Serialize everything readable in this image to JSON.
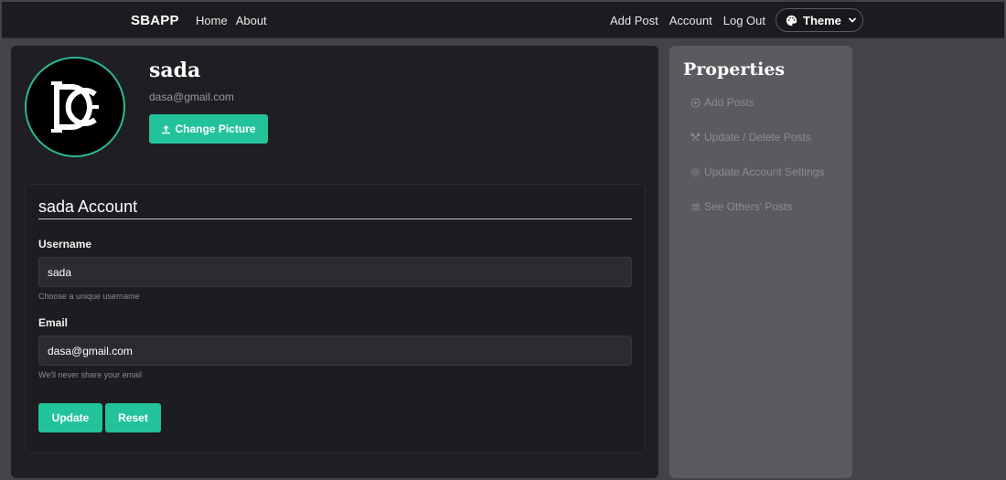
{
  "navbar": {
    "brand": "SBAPP",
    "left_links": [
      "Home",
      "About"
    ],
    "right_links": [
      "Add Post",
      "Account",
      "Log Out"
    ],
    "theme_label": "Theme"
  },
  "profile": {
    "avatar_icon": "dc-monogram-logo",
    "name": "sada",
    "email": "dasa@gmail.com",
    "change_picture_label": "Change Picture"
  },
  "account_form": {
    "title": "sada Account",
    "username": {
      "label": "Username",
      "value": "sada",
      "help": "Choose a unique username"
    },
    "email": {
      "label": "Email",
      "value": "dasa@gmail.com",
      "help": "We'll never share your email"
    },
    "update_label": "Update",
    "reset_label": "Reset"
  },
  "sidebar": {
    "title": "Properties",
    "items": [
      {
        "label": "Add Posts",
        "icon": "plus-circle-icon"
      },
      {
        "label": "Update / Delete Posts",
        "icon": "tools-icon"
      },
      {
        "label": "Update Account Settings",
        "icon": "gear-icon"
      },
      {
        "label": "See Others' Posts",
        "icon": "users-icon"
      }
    ]
  },
  "colors": {
    "accent": "#22c39b",
    "navbar_bg": "#1c1b1f",
    "card_bg": "#1f1e22",
    "sidebar_bg": "#5b5a5f",
    "page_bg": "#444347"
  }
}
